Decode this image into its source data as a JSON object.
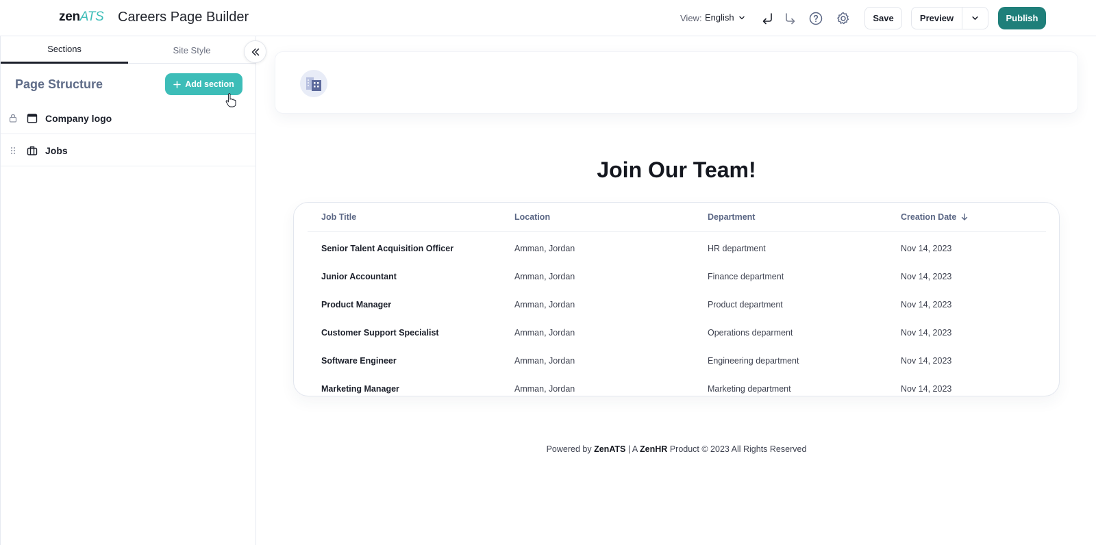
{
  "app": {
    "logo_zen": "zen",
    "logo_ats": "ATS",
    "title": "Careers Page Builder"
  },
  "toolbar": {
    "view_label": "View:",
    "view_value": "English",
    "save_label": "Save",
    "preview_label": "Preview",
    "publish_label": "Publish",
    "icons": [
      "undo-icon",
      "redo-icon",
      "help-icon",
      "settings-icon"
    ]
  },
  "sidebar": {
    "tabs": [
      {
        "label": "Sections",
        "active": true
      },
      {
        "label": "Site Style",
        "active": false
      }
    ],
    "structure_title": "Page Structure",
    "add_section_label": "Add section",
    "items": [
      {
        "label": "Company logo",
        "icon": "browser-window-icon",
        "handle": "lock-icon"
      },
      {
        "label": "Jobs",
        "icon": "briefcase-icon",
        "handle": "drag-handle-icon"
      }
    ]
  },
  "canvas": {
    "heading": "Join Our Team!",
    "table": {
      "columns": [
        "Job Title",
        "Location",
        "Department",
        "Creation Date"
      ],
      "sort_column": "Creation Date",
      "rows": [
        [
          "Senior Talent Acquisition Officer",
          "Amman, Jordan",
          "HR department",
          "Nov 14, 2023"
        ],
        [
          "Junior Accountant",
          "Amman, Jordan",
          "Finance department",
          "Nov 14, 2023"
        ],
        [
          "Product Manager",
          "Amman, Jordan",
          "Product department",
          "Nov 14, 2023"
        ],
        [
          "Customer Support Specialist",
          "Amman, Jordan",
          "Operations deparment",
          "Nov 14, 2023"
        ],
        [
          "Software Engineer",
          "Amman, Jordan",
          "Engineering department",
          "Nov 14, 2023"
        ],
        [
          "Marketing Manager",
          "Amman, Jordan",
          "Marketing department",
          "Nov 14, 2023"
        ]
      ]
    },
    "footer": {
      "powered_by": "Powered by",
      "brand1": "ZenATS",
      "sep": "| A",
      "brand2": "ZenHR",
      "rest": "Product © 2023 All Rights Reserved"
    }
  },
  "colors": {
    "accent": "#3dbdb8",
    "publish": "#1f7f7a",
    "structure_title": "#5f6c88"
  }
}
